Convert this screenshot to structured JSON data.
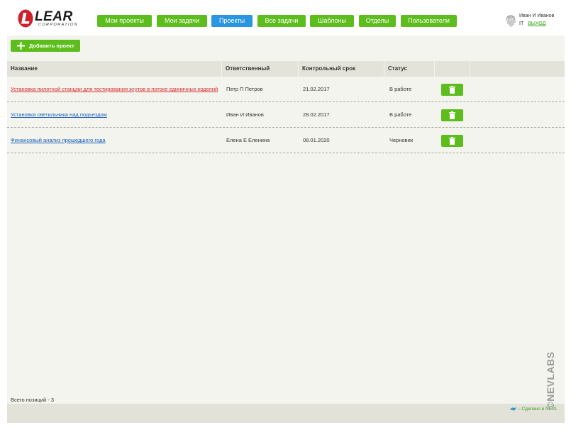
{
  "brand": {
    "name": "LEAR",
    "subtitle": "CORPORATION"
  },
  "nav": [
    {
      "label": "Мои проекты",
      "active": false
    },
    {
      "label": "Мои задачи",
      "active": false
    },
    {
      "label": "Проекты",
      "active": true
    },
    {
      "label": "Все задачи",
      "active": false
    },
    {
      "label": "Шаблоны",
      "active": false
    },
    {
      "label": "Отделы",
      "active": false
    },
    {
      "label": "Пользователи",
      "active": false
    }
  ],
  "user": {
    "name": "Иван И Иванов",
    "dept": "IT",
    "logout": "ВЫХОД"
  },
  "toolbar": {
    "add_label": "Добавить проект"
  },
  "table": {
    "headers": [
      "Название",
      "Ответственный",
      "Контрольный срок",
      "Статус"
    ],
    "rows": [
      {
        "name": "Установка пилотной станции для тестирования жгутов в потоке единичных изделий",
        "owner": "Петр П Петров",
        "deadline": "21.02.2017",
        "status": "В работе"
      },
      {
        "name": "Установка светильника над подъездом",
        "owner": "Иван И Иванов",
        "deadline": "28.02.2017",
        "status": "В работе"
      },
      {
        "name": "Финансовый анализ прошедшего года",
        "owner": "Елена Е Еленина",
        "deadline": "08.01.2020",
        "status": "Черновик"
      }
    ]
  },
  "total": "Всего позиций - 3",
  "footer": {
    "made_by": "– Сделано в NEVL",
    "watermark": "©NEVLABS"
  },
  "colors": {
    "green": "#5cbd1c",
    "blue": "#2b96e0",
    "link": "#1a5fb4",
    "link_visited": "#d42b2b"
  },
  "icons": {
    "add": "plus-icon",
    "delete": "trash-icon",
    "user": "fingerprint-icon"
  }
}
